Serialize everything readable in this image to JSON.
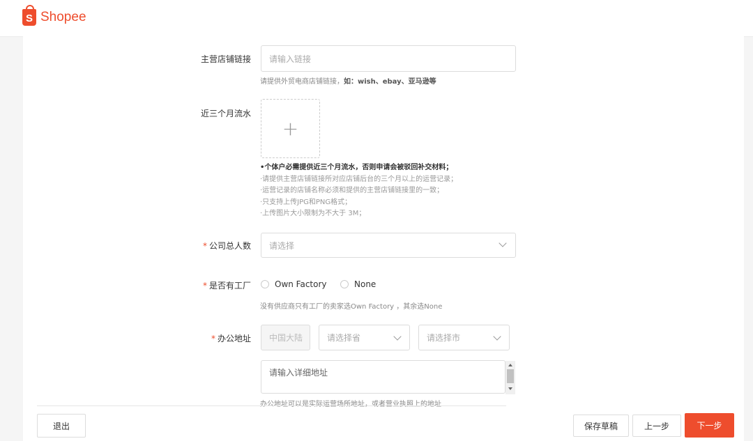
{
  "brand": {
    "name": "Shopee",
    "bag_letter": "S",
    "color": "#ee4d2d"
  },
  "fields": {
    "store_link": {
      "label": "主营店铺链接",
      "placeholder": "请输入链接",
      "hint_prefix": "请提供外贸电商店铺链接，",
      "hint_bold": "如：wish、ebay、亚马逊等"
    },
    "turnover": {
      "label": "近三个月流水",
      "upload_icon": "plus-icon",
      "notes": [
        "•个体户必需提供近三个月流水，否则申请会被驳回补交材料；",
        "·请提供主营店铺链接所对应店铺后台的三个月以上的运营记录；",
        "·运营记录的店铺名称必须和提供的主营店铺链接里的一致；",
        "·只支持上传JPG和PNG格式；",
        "·上传图片大小限制为不大于 3M；"
      ]
    },
    "headcount": {
      "required_mark": "*",
      "label": "公司总人数",
      "placeholder": "请选择"
    },
    "factory": {
      "required_mark": "*",
      "label": "是否有工厂",
      "options": [
        "Own Factory",
        "None"
      ],
      "hint": "没有供应商只有工厂的卖家选Own Factory ，其余选None"
    },
    "address": {
      "required_mark": "*",
      "label": "办公地址",
      "country": "中国大陆",
      "province_placeholder": "请选择省",
      "city_placeholder": "请选择市",
      "detail_placeholder": "请输入详细地址",
      "hint": "办公地址可以是实际运营场所地址，或者营业执照上的地址"
    }
  },
  "footer": {
    "exit": "退出",
    "save_draft": "保存草稿",
    "prev": "上一步",
    "next": "下一步"
  }
}
